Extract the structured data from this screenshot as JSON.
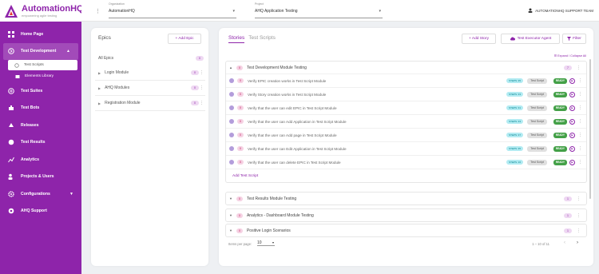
{
  "app": {
    "name": "AutomationHQ",
    "tagline": "empowering agile testing"
  },
  "sidebar": {
    "items": [
      {
        "label": "Home Page",
        "icon": "grid-icon"
      },
      {
        "label": "Test Development",
        "icon": "code-icon"
      },
      {
        "label": "Test Suites",
        "icon": "suites-icon"
      },
      {
        "label": "Test Bots",
        "icon": "bot-icon"
      },
      {
        "label": "Releases",
        "icon": "release-icon"
      },
      {
        "label": "Test Results",
        "icon": "results-icon"
      },
      {
        "label": "Analytics",
        "icon": "analytics-icon"
      },
      {
        "label": "Projects & Users",
        "icon": "users-icon"
      },
      {
        "label": "Configurations",
        "icon": "gear-icon"
      },
      {
        "label": "AHQ Support",
        "icon": "support-icon"
      }
    ],
    "sub_items": [
      {
        "label": "Test Scripts"
      },
      {
        "label": "Elements Library"
      }
    ]
  },
  "topbar": {
    "organization": {
      "label": "Organization",
      "value": "AutomationHQ"
    },
    "project": {
      "label": "Project",
      "value": "AHQ Application Testing"
    },
    "user": "AUTOMATIONHQ SUPPORT TEAM"
  },
  "epics": {
    "title": "Epics",
    "add_label": "+ Add Epic",
    "all_label": "All Epics",
    "all_count": "0",
    "items": [
      {
        "name": "Login Module",
        "count": "0"
      },
      {
        "name": "AHQ Modules",
        "count": "0"
      },
      {
        "name": "Registration Module",
        "count": "0"
      }
    ]
  },
  "main": {
    "tabs": [
      "Stories",
      "Test Scripts"
    ],
    "add_story": "+ Add Story",
    "executor": "Test Executor Agent",
    "filter": "Filter",
    "expand": "Expand / Collapse All",
    "groups": [
      {
        "title": "Test Development Module Testing",
        "count": "0",
        "badge": "7",
        "scripts": [
          {
            "title": "Verify EPIC creation works in Test Script Module",
            "steps": "STEPS: 35",
            "type": "Test Script",
            "status": "READY"
          },
          {
            "title": "Verify Story creation works in Test Script Module",
            "steps": "STEPS: 33",
            "type": "Test Script",
            "status": "READY"
          },
          {
            "title": "Verify that the user can edit EPIC in Test Script Module",
            "steps": "STEPS: 31",
            "type": "Test Script",
            "status": "READY"
          },
          {
            "title": "Verify that the user can Add Application in Test Script Module",
            "steps": "STEPS: 33",
            "type": "Test Script",
            "status": "READY"
          },
          {
            "title": "Verify that the user can Add page in Test Script Module",
            "steps": "STEPS: 37",
            "type": "Test Script",
            "status": "READY"
          },
          {
            "title": "Verify that the user can Edit Application in Test Script Module",
            "steps": "STEPS: 35",
            "type": "Test Script",
            "status": "READY"
          },
          {
            "title": "Verify that the user can delete EPIC in Test Script Module",
            "steps": "STEPS: 16",
            "type": "Test Script",
            "status": "READY"
          }
        ],
        "add_label": "Add Test Script"
      },
      {
        "title": "Test Results Module Testing",
        "count": "0",
        "badge": "1"
      },
      {
        "title": "Analytics - Dashboard Module Testing",
        "count": "0",
        "badge": "1"
      },
      {
        "title": "Positive Login Scenarios",
        "count": "0",
        "badge": "1"
      }
    ],
    "pager": {
      "items_label": "Items per page:",
      "items_value": "10",
      "range": "1 – 10 of 11"
    }
  },
  "colors": {
    "brand": "#8e24aa",
    "ready": "#43a047",
    "steps": "#b2ebf2"
  }
}
